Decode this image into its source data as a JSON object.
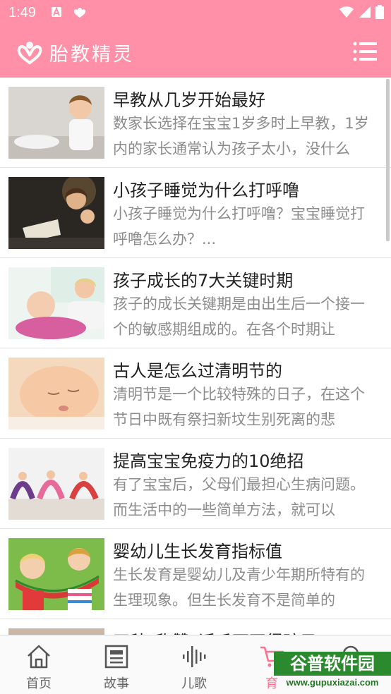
{
  "status_bar": {
    "time": "1:49"
  },
  "app_bar": {
    "title": "胎教精灵"
  },
  "articles": [
    {
      "title": "早教从几岁开始最好",
      "summary": "数家长选择在宝宝1岁多时上早教，1岁内的家长通常认为孩子太小，没什么",
      "thumb": "boy-at-table"
    },
    {
      "title": "小孩子睡觉为什么打呼噜",
      "summary": "小孩子睡觉为什么打呼噜？宝宝睡觉打呼噜怎么办？...",
      "thumb": "mother-reading-bedtime"
    },
    {
      "title": "孩子成长的7大关键时期",
      "summary": "孩子的成长关键期是由出生后一个接一个的敏感期组成的。在各个时期让",
      "thumb": "baby-with-mother"
    },
    {
      "title": "古人是怎么过清明节的",
      "summary": "清明节是一个比较特殊的日子，在这个节日中既有祭扫新坟生别死离的悲",
      "thumb": "sleeping-baby"
    },
    {
      "title": "提高宝宝免疫力的10绝招",
      "summary": "有了宝宝后，父母们最担心生病问题。而生活中的一些简单方法，就可以",
      "thumb": "kids-gymnastics"
    },
    {
      "title": "婴幼儿生长发育指标值",
      "summary": "生长发育是婴幼儿及青少年期所特有的生理现象。但生长发育不是简单的",
      "thumb": "kids-watermelon"
    },
    {
      "title": "四种“称赞”话千万不得孩子",
      "summary": "",
      "thumb": "partial-item"
    }
  ],
  "tabs": [
    {
      "label": "首页",
      "icon": "home-icon"
    },
    {
      "label": "故事",
      "icon": "book-icon"
    },
    {
      "label": "儿歌",
      "icon": "sound-wave-icon"
    },
    {
      "label": "育",
      "icon": "cart-icon"
    },
    {
      "label": "",
      "icon": "search-icon"
    }
  ],
  "watermark": {
    "title": "谷普软件园",
    "url": "www.gupuxiazai.com"
  },
  "colors": {
    "primary": "#ff90a7",
    "tab_active": "#ff6f8f",
    "watermark": "#2b8a2d"
  }
}
